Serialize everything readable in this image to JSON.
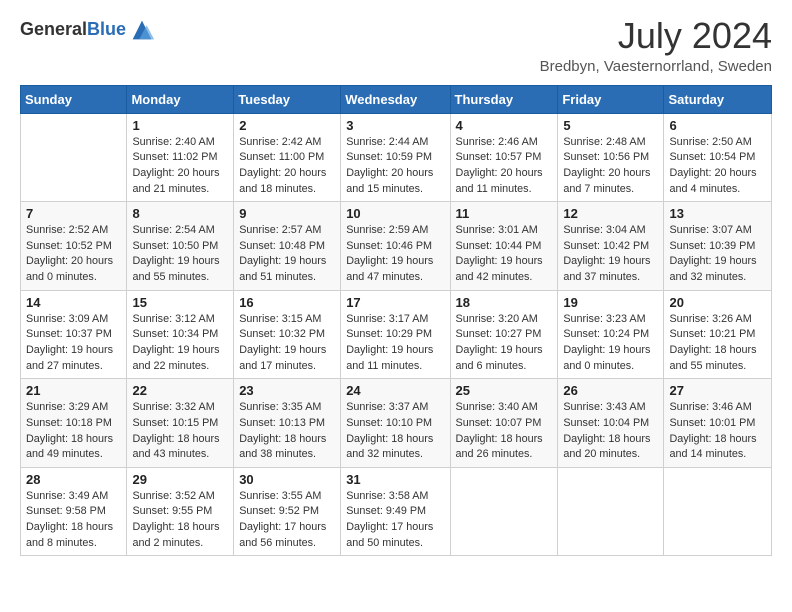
{
  "header": {
    "logo_general": "General",
    "logo_blue": "Blue",
    "month_year": "July 2024",
    "location": "Bredbyn, Vaesternorrland, Sweden"
  },
  "days_of_week": [
    "Sunday",
    "Monday",
    "Tuesday",
    "Wednesday",
    "Thursday",
    "Friday",
    "Saturday"
  ],
  "weeks": [
    [
      {
        "date": "",
        "info": ""
      },
      {
        "date": "1",
        "info": "Sunrise: 2:40 AM\nSunset: 11:02 PM\nDaylight: 20 hours\nand 21 minutes."
      },
      {
        "date": "2",
        "info": "Sunrise: 2:42 AM\nSunset: 11:00 PM\nDaylight: 20 hours\nand 18 minutes."
      },
      {
        "date": "3",
        "info": "Sunrise: 2:44 AM\nSunset: 10:59 PM\nDaylight: 20 hours\nand 15 minutes."
      },
      {
        "date": "4",
        "info": "Sunrise: 2:46 AM\nSunset: 10:57 PM\nDaylight: 20 hours\nand 11 minutes."
      },
      {
        "date": "5",
        "info": "Sunrise: 2:48 AM\nSunset: 10:56 PM\nDaylight: 20 hours\nand 7 minutes."
      },
      {
        "date": "6",
        "info": "Sunrise: 2:50 AM\nSunset: 10:54 PM\nDaylight: 20 hours\nand 4 minutes."
      }
    ],
    [
      {
        "date": "7",
        "info": "Sunrise: 2:52 AM\nSunset: 10:52 PM\nDaylight: 20 hours\nand 0 minutes."
      },
      {
        "date": "8",
        "info": "Sunrise: 2:54 AM\nSunset: 10:50 PM\nDaylight: 19 hours\nand 55 minutes."
      },
      {
        "date": "9",
        "info": "Sunrise: 2:57 AM\nSunset: 10:48 PM\nDaylight: 19 hours\nand 51 minutes."
      },
      {
        "date": "10",
        "info": "Sunrise: 2:59 AM\nSunset: 10:46 PM\nDaylight: 19 hours\nand 47 minutes."
      },
      {
        "date": "11",
        "info": "Sunrise: 3:01 AM\nSunset: 10:44 PM\nDaylight: 19 hours\nand 42 minutes."
      },
      {
        "date": "12",
        "info": "Sunrise: 3:04 AM\nSunset: 10:42 PM\nDaylight: 19 hours\nand 37 minutes."
      },
      {
        "date": "13",
        "info": "Sunrise: 3:07 AM\nSunset: 10:39 PM\nDaylight: 19 hours\nand 32 minutes."
      }
    ],
    [
      {
        "date": "14",
        "info": "Sunrise: 3:09 AM\nSunset: 10:37 PM\nDaylight: 19 hours\nand 27 minutes."
      },
      {
        "date": "15",
        "info": "Sunrise: 3:12 AM\nSunset: 10:34 PM\nDaylight: 19 hours\nand 22 minutes."
      },
      {
        "date": "16",
        "info": "Sunrise: 3:15 AM\nSunset: 10:32 PM\nDaylight: 19 hours\nand 17 minutes."
      },
      {
        "date": "17",
        "info": "Sunrise: 3:17 AM\nSunset: 10:29 PM\nDaylight: 19 hours\nand 11 minutes."
      },
      {
        "date": "18",
        "info": "Sunrise: 3:20 AM\nSunset: 10:27 PM\nDaylight: 19 hours\nand 6 minutes."
      },
      {
        "date": "19",
        "info": "Sunrise: 3:23 AM\nSunset: 10:24 PM\nDaylight: 19 hours\nand 0 minutes."
      },
      {
        "date": "20",
        "info": "Sunrise: 3:26 AM\nSunset: 10:21 PM\nDaylight: 18 hours\nand 55 minutes."
      }
    ],
    [
      {
        "date": "21",
        "info": "Sunrise: 3:29 AM\nSunset: 10:18 PM\nDaylight: 18 hours\nand 49 minutes."
      },
      {
        "date": "22",
        "info": "Sunrise: 3:32 AM\nSunset: 10:15 PM\nDaylight: 18 hours\nand 43 minutes."
      },
      {
        "date": "23",
        "info": "Sunrise: 3:35 AM\nSunset: 10:13 PM\nDaylight: 18 hours\nand 38 minutes."
      },
      {
        "date": "24",
        "info": "Sunrise: 3:37 AM\nSunset: 10:10 PM\nDaylight: 18 hours\nand 32 minutes."
      },
      {
        "date": "25",
        "info": "Sunrise: 3:40 AM\nSunset: 10:07 PM\nDaylight: 18 hours\nand 26 minutes."
      },
      {
        "date": "26",
        "info": "Sunrise: 3:43 AM\nSunset: 10:04 PM\nDaylight: 18 hours\nand 20 minutes."
      },
      {
        "date": "27",
        "info": "Sunrise: 3:46 AM\nSunset: 10:01 PM\nDaylight: 18 hours\nand 14 minutes."
      }
    ],
    [
      {
        "date": "28",
        "info": "Sunrise: 3:49 AM\nSunset: 9:58 PM\nDaylight: 18 hours\nand 8 minutes."
      },
      {
        "date": "29",
        "info": "Sunrise: 3:52 AM\nSunset: 9:55 PM\nDaylight: 18 hours\nand 2 minutes."
      },
      {
        "date": "30",
        "info": "Sunrise: 3:55 AM\nSunset: 9:52 PM\nDaylight: 17 hours\nand 56 minutes."
      },
      {
        "date": "31",
        "info": "Sunrise: 3:58 AM\nSunset: 9:49 PM\nDaylight: 17 hours\nand 50 minutes."
      },
      {
        "date": "",
        "info": ""
      },
      {
        "date": "",
        "info": ""
      },
      {
        "date": "",
        "info": ""
      }
    ]
  ]
}
